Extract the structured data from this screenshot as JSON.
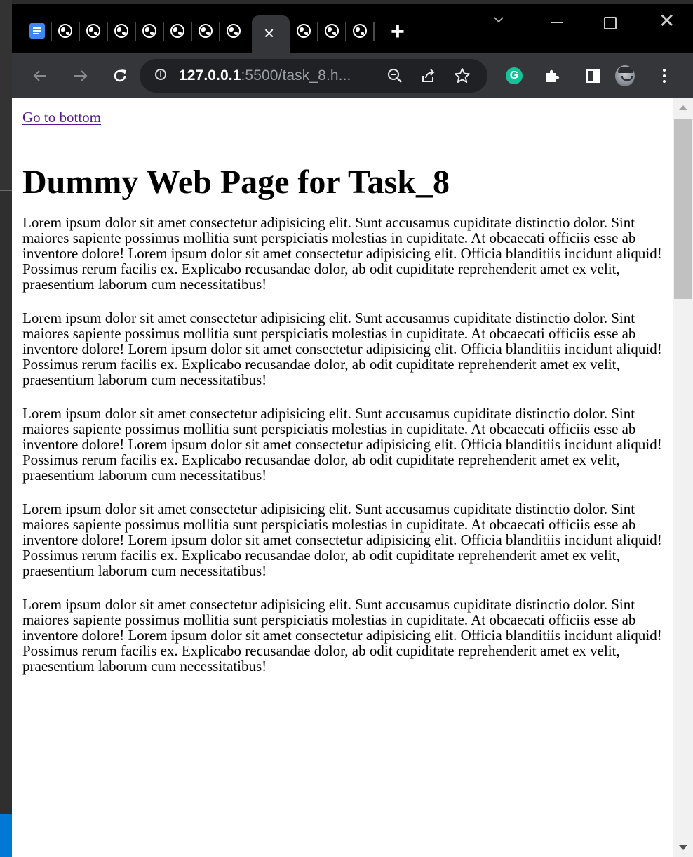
{
  "browser": {
    "tabs": {
      "first_icon": "docs-icon",
      "site_icon": "globe-icon",
      "active_close": "×",
      "new_tab": "+"
    },
    "toolbar": {
      "back_icon": "←",
      "forward_icon": "→",
      "reload_icon": "C"
    },
    "address_bar": {
      "host": "127.0.0.1",
      "rest": ":5500/task_8.h..."
    },
    "extensions": {
      "grammarly_label": "G"
    }
  },
  "page": {
    "link_text": "Go to bottom",
    "heading": "Dummy Web Page for Task_8",
    "paragraphs": [
      "Lorem ipsum dolor sit amet consectetur adipisicing elit. Sunt accusamus cupiditate distinctio dolor. Sint maiores sapiente possimus mollitia sunt perspiciatis molestias in cupiditate. At obcaecati officiis esse ab inventore dolore! Lorem ipsum dolor sit amet consectetur adipisicing elit. Officia blanditiis incidunt aliquid! Possimus rerum facilis ex. Explicabo recusandae dolor, ab odit cupiditate reprehenderit amet ex velit, praesentium laborum cum necessitatibus!",
      "Lorem ipsum dolor sit amet consectetur adipisicing elit. Sunt accusamus cupiditate distinctio dolor. Sint maiores sapiente possimus mollitia sunt perspiciatis molestias in cupiditate. At obcaecati officiis esse ab inventore dolore! Lorem ipsum dolor sit amet consectetur adipisicing elit. Officia blanditiis incidunt aliquid! Possimus rerum facilis ex. Explicabo recusandae dolor, ab odit cupiditate reprehenderit amet ex velit, praesentium laborum cum necessitatibus!",
      "Lorem ipsum dolor sit amet consectetur adipisicing elit. Sunt accusamus cupiditate distinctio dolor. Sint maiores sapiente possimus mollitia sunt perspiciatis molestias in cupiditate. At obcaecati officiis esse ab inventore dolore! Lorem ipsum dolor sit amet consectetur adipisicing elit. Officia blanditiis incidunt aliquid! Possimus rerum facilis ex. Explicabo recusandae dolor, ab odit cupiditate reprehenderit amet ex velit, praesentium laborum cum necessitatibus!",
      "Lorem ipsum dolor sit amet consectetur adipisicing elit. Sunt accusamus cupiditate distinctio dolor. Sint maiores sapiente possimus mollitia sunt perspiciatis molestias in cupiditate. At obcaecati officiis esse ab inventore dolore! Lorem ipsum dolor sit amet consectetur adipisicing elit. Officia blanditiis incidunt aliquid! Possimus rerum facilis ex. Explicabo recusandae dolor, ab odit cupiditate reprehenderit amet ex velit, praesentium laborum cum necessitatibus!",
      "Lorem ipsum dolor sit amet consectetur adipisicing elit. Sunt accusamus cupiditate distinctio dolor. Sint maiores sapiente possimus mollitia sunt perspiciatis molestias in cupiditate. At obcaecati officiis esse ab inventore dolore! Lorem ipsum dolor sit amet consectetur adipisicing elit. Officia blanditiis incidunt aliquid! Possimus rerum facilis ex. Explicabo recusandae dolor, ab odit cupiditate reprehenderit amet ex velit, praesentium laborum cum necessitatibus!"
    ]
  }
}
